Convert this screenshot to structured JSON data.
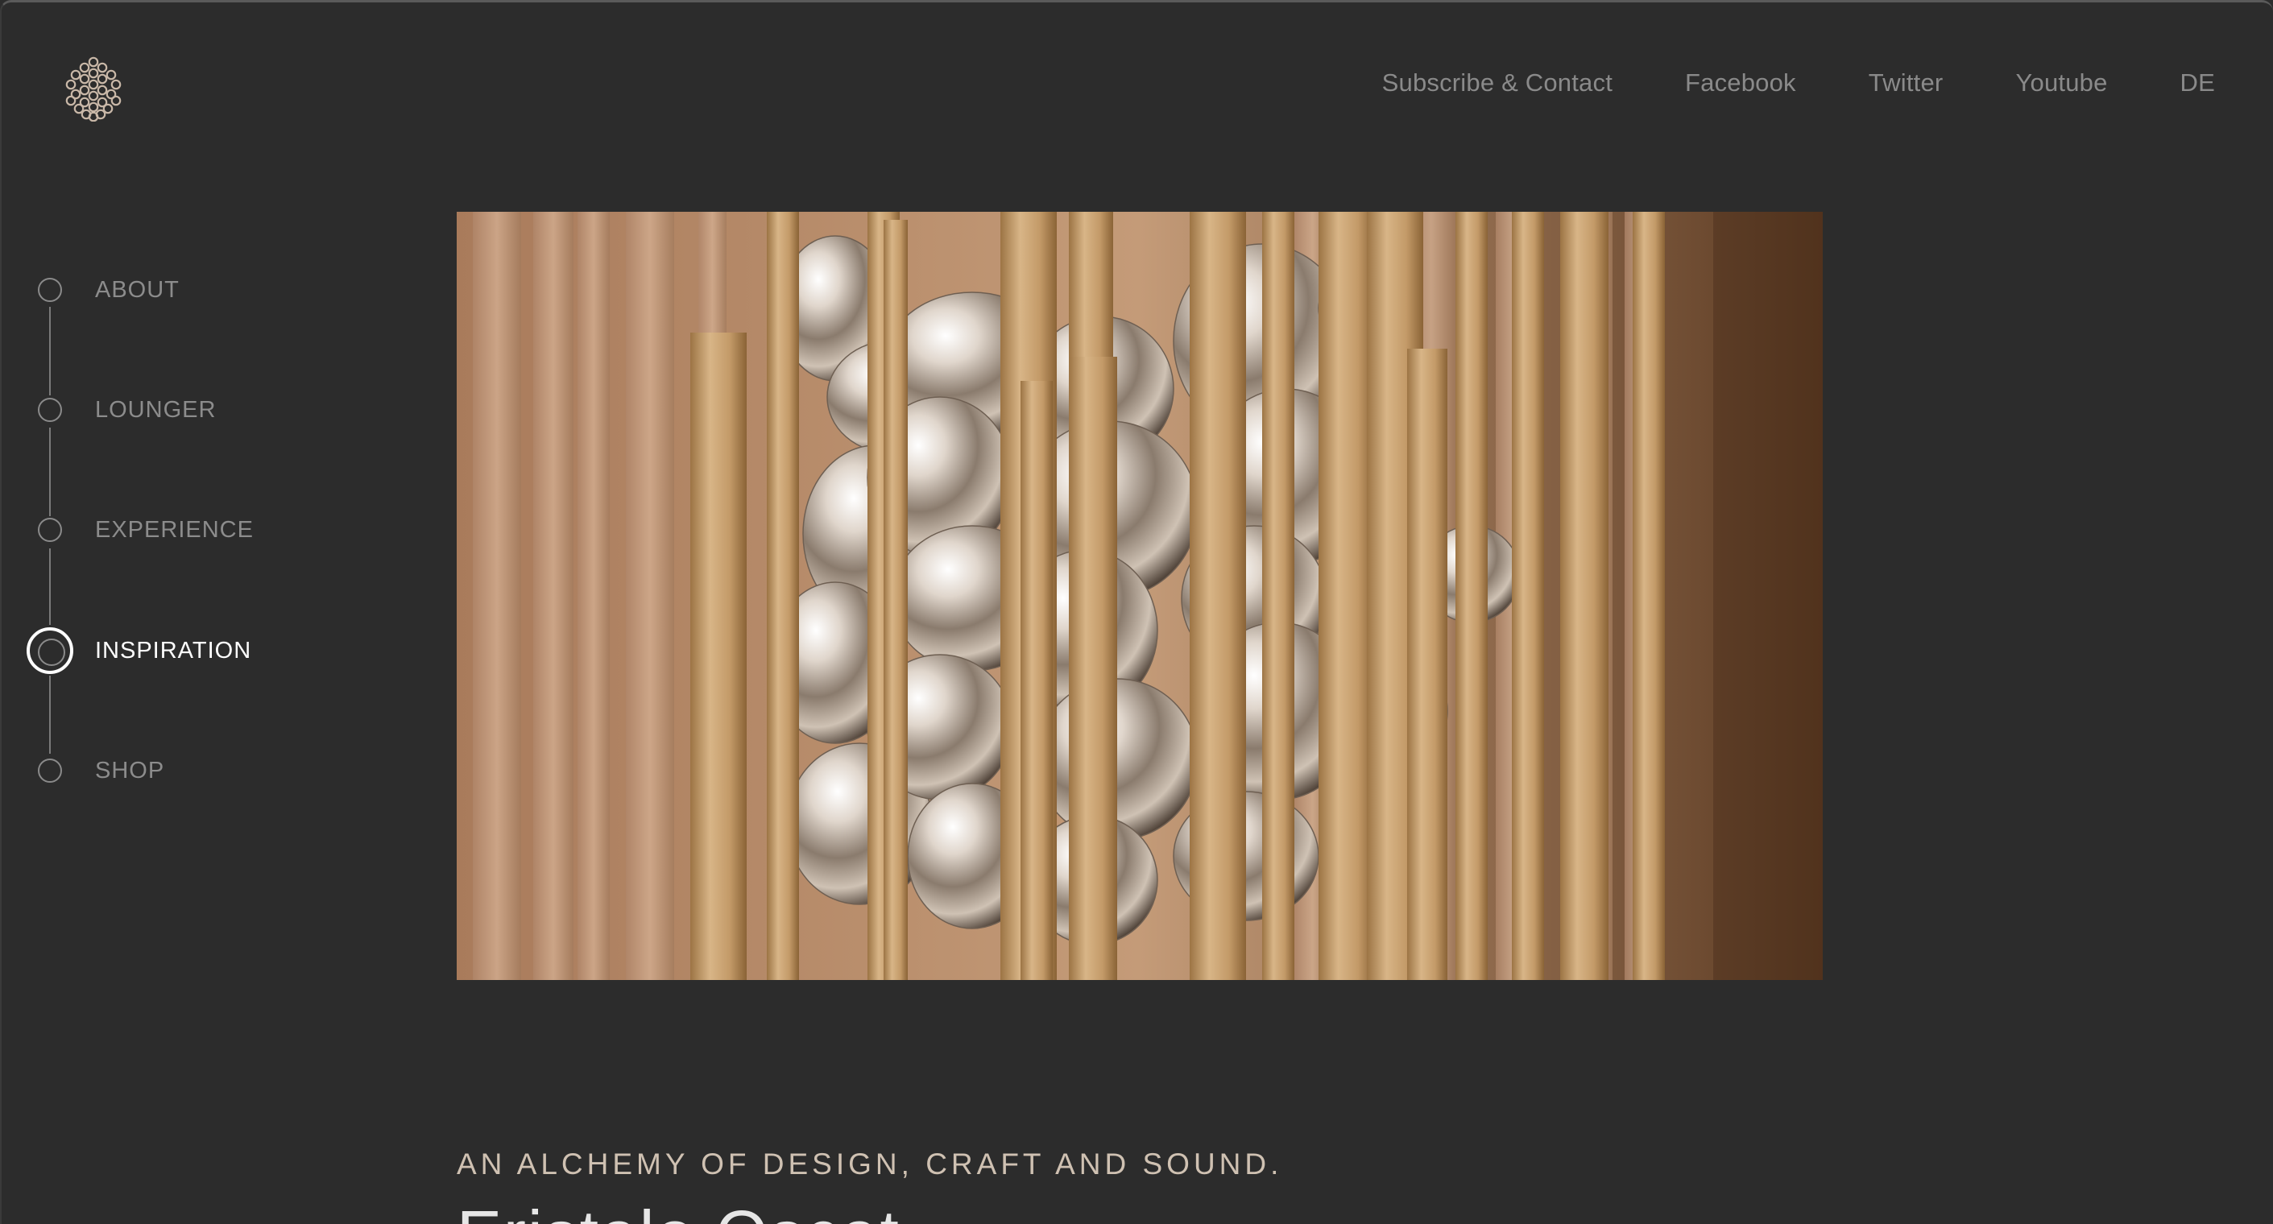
{
  "header": {
    "logo_icon": "honeycomb-logo-icon",
    "nav": [
      {
        "label": "Subscribe & Contact"
      },
      {
        "label": "Facebook"
      },
      {
        "label": "Twitter"
      },
      {
        "label": "Youtube"
      },
      {
        "label": "DE"
      }
    ]
  },
  "sidebar": {
    "items": [
      {
        "label": "ABOUT",
        "active": false
      },
      {
        "label": "LOUNGER",
        "active": false
      },
      {
        "label": "EXPERIENCE",
        "active": false
      },
      {
        "label": "INSPIRATION",
        "active": true
      },
      {
        "label": "SHOP",
        "active": false
      }
    ]
  },
  "hero": {
    "media_icon": "chrome-blobs-wooden-slats-image"
  },
  "content": {
    "tagline": "AN ALCHEMY OF DESIGN, CRAFT AND SOUND.",
    "headline": "Eristalo Oscat"
  },
  "colors": {
    "background": "#2c2c2c",
    "nav_text": "#8a8a8a",
    "active_text": "#ffffff",
    "tagline": "#cfc1b2"
  }
}
